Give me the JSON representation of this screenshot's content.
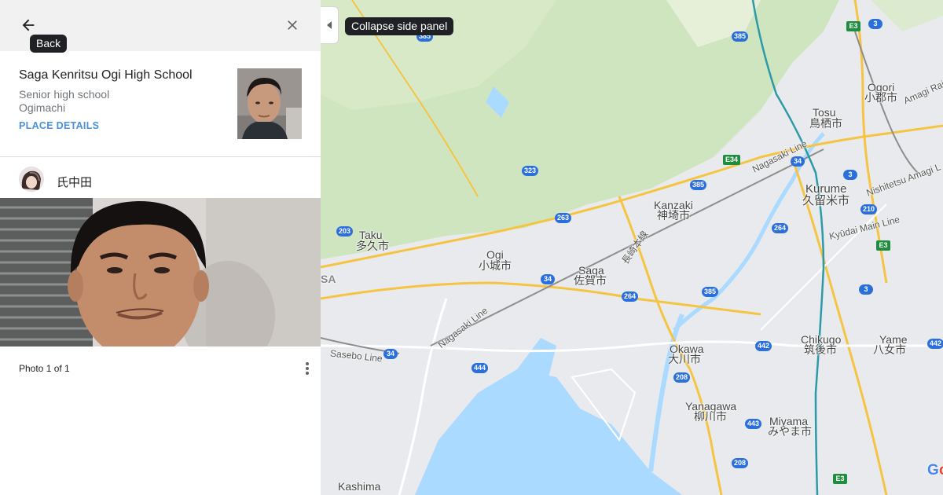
{
  "panel": {
    "back_tooltip": "Back",
    "place": {
      "name": "Saga Kenritsu Ogi High School",
      "category": "Senior high school",
      "locality": "Ogimachi",
      "details_link": "PLACE DETAILS"
    },
    "uploader": {
      "name": "氏中田"
    },
    "photo_count": "Photo 1 of 1"
  },
  "map": {
    "collapse_tooltip": "Collapse side panel",
    "logo": "Google",
    "places": {
      "taku_en": "Taku",
      "taku_ja": "多久市",
      "ogi_en": "Ogi",
      "ogi_ja": "小城市",
      "saga_en": "Saga",
      "saga_ja": "佐賀市",
      "kanzaki_en": "Kanzaki",
      "kanzaki_ja": "神埼市",
      "tosu_en": "Tosu",
      "tosu_ja": "鳥栖市",
      "ogori_en": "Ogori",
      "ogori_ja": "小郡市",
      "kurume_en": "Kurume",
      "kurume_ja": "久留米市",
      "okawa_en": "Okawa",
      "okawa_ja": "大川市",
      "chikugo_en": "Chikugo",
      "chikugo_ja": "筑後市",
      "yame_en": "Yame",
      "yame_ja": "八女市",
      "yanagawa_en": "Yanagawa",
      "yanagawa_ja": "柳川市",
      "miyama_en": "Miyama",
      "miyama_ja": "みやま市",
      "kashima_en": "Kashima",
      "edge_sa": "SA"
    },
    "rail_lines": {
      "nagasaki_line_ne": "Nagasaki Line",
      "nagasaki_line_sw": "Nagasaki Line",
      "nagasaki_honsen": "長崎本線",
      "sasebo_line": "Sasebo Line",
      "amagi_rail": "Amagi Rail",
      "nishitetsu_amagi": "Nishitetsu Amagi L",
      "kyudai_main": "Kyūdai Main Line"
    },
    "route_shields": {
      "r385a": "385",
      "r385b": "385",
      "r385c": "385",
      "r323": "323",
      "r263": "263",
      "r203": "203",
      "r34a": "34",
      "r34b": "34",
      "r34c": "34",
      "r264a": "264",
      "r264b": "264",
      "r3a": "3",
      "r3b": "3",
      "r3c": "3",
      "r210": "210",
      "r442a": "442",
      "r442b": "442",
      "r444": "444",
      "r208a": "208",
      "r208b": "208",
      "r443": "443",
      "e3a": "E3",
      "e34": "E34",
      "e3b": "E3",
      "e3c": "E3"
    },
    "colors": {
      "water": "#aadaff",
      "green": "#cfe8c3",
      "land": "#e8eaed",
      "highway": "#f5c443",
      "route_shield": "#2a6fdb"
    }
  }
}
